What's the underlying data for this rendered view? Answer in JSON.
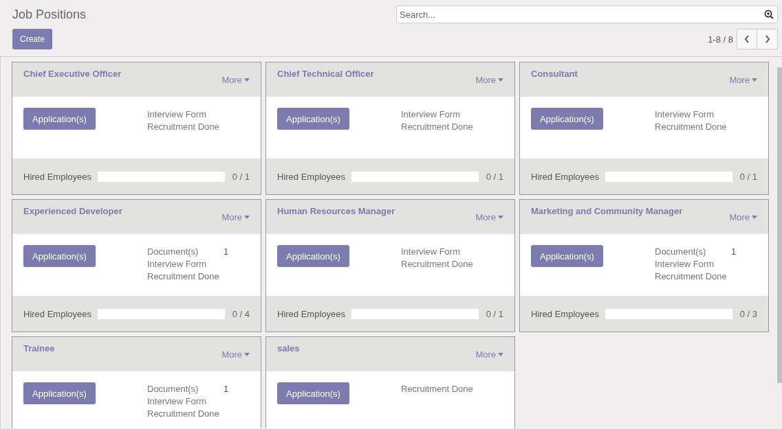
{
  "page_title": "Job Positions",
  "create_button": "Create",
  "search": {
    "placeholder": "Search..."
  },
  "pager": {
    "text": "1-8 / 8"
  },
  "jobs": [
    {
      "title": "Chief Executive Officer",
      "more": "More",
      "applications": "Application(s)",
      "links": [
        {
          "label": "Interview Form"
        },
        {
          "label": "Recruitment Done"
        }
      ],
      "hired_label": "Hired Employees",
      "level": 0,
      "reading": "0 / 1"
    },
    {
      "title": "Chief Technical Officer",
      "more": "More",
      "applications": "Application(s)",
      "links": [
        {
          "label": "Interview Form"
        },
        {
          "label": "Recruitment Done"
        }
      ],
      "hired_label": "Hired Employees",
      "level": 0,
      "reading": "0 / 1"
    },
    {
      "title": "Consultant",
      "more": "More",
      "applications": "Application(s)",
      "links": [
        {
          "label": "Interview Form"
        },
        {
          "label": "Recruitment Done"
        }
      ],
      "hired_label": "Hired Employees",
      "level": 0,
      "reading": "0 / 1"
    },
    {
      "title": "Experienced Developer",
      "more": "More",
      "applications": "Application(s)",
      "links": [
        {
          "label": "Document(s)",
          "count": "1"
        },
        {
          "label": "Interview Form"
        },
        {
          "label": "Recruitment Done"
        }
      ],
      "hired_label": "Hired Employees",
      "level": 0,
      "reading": "0 / 4"
    },
    {
      "title": "Human Resources Manager",
      "more": "More",
      "applications": "Application(s)",
      "links": [
        {
          "label": "Interview Form"
        },
        {
          "label": "Recruitment Done"
        }
      ],
      "hired_label": "Hired Employees",
      "level": 0,
      "reading": "0 / 1"
    },
    {
      "title": "Marketing and Community Manager",
      "more": "More",
      "applications": "Application(s)",
      "links": [
        {
          "label": "Document(s)",
          "count": "1"
        },
        {
          "label": "Interview Form"
        },
        {
          "label": "Recruitment Done"
        }
      ],
      "hired_label": "Hired Employees",
      "level": 0,
      "reading": "0 / 3"
    },
    {
      "title": "Trainee",
      "more": "More",
      "applications": "Application(s)",
      "links": [
        {
          "label": "Document(s)",
          "count": "1"
        },
        {
          "label": "Interview Form"
        },
        {
          "label": "Recruitment Done"
        }
      ]
    },
    {
      "title": "sales",
      "more": "More",
      "applications": "Application(s)",
      "links": [
        {
          "label": "Recruitment Done"
        }
      ]
    }
  ]
}
